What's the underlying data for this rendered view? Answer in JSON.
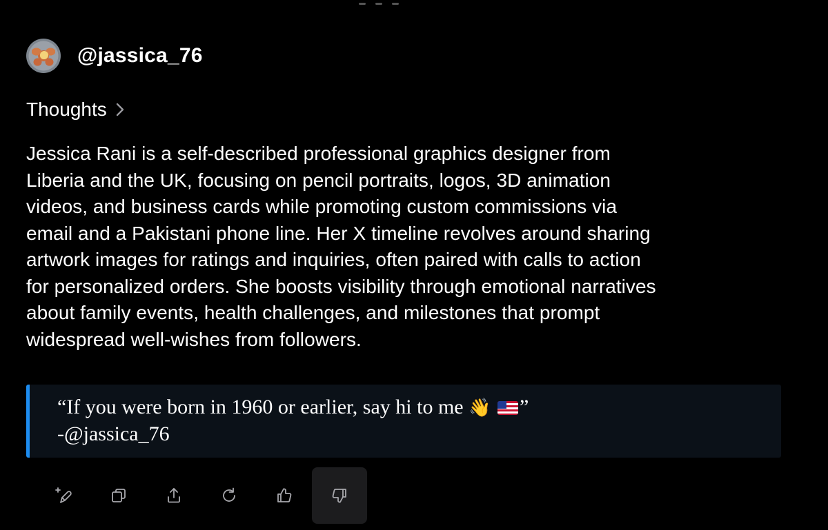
{
  "user": {
    "handle": "@jassica_76"
  },
  "thoughts": {
    "label": "Thoughts"
  },
  "summary": {
    "lines": [
      "Jessica Rani is a self-described professional graphics designer from",
      "Liberia and the UK, focusing on pencil portraits, logos, 3D animation",
      "videos, and business cards while promoting custom commissions via",
      "email and a Pakistani phone line. Her X timeline revolves around sharing",
      "artwork images for ratings and inquiries, often paired with calls to action",
      "for personalized orders. She boosts visibility through emotional narratives",
      "about family events, health challenges, and milestones that prompt",
      "widespread well-wishes from followers."
    ]
  },
  "quote": {
    "text_before_emoji": "“If you were born in 1960 or earlier, say hi to me",
    "wave_emoji": "👋",
    "flag_emoji": "🇺🇸",
    "closing_mark": "”",
    "attribution": "-@jassica_76",
    "accent_color": "#1d8cf0"
  },
  "toolbar": {
    "icons": [
      "edit-sparkle-icon",
      "copy-icon",
      "share-icon",
      "regenerate-icon",
      "thumbs-up-icon",
      "thumbs-down-icon"
    ],
    "active": "thumbs-down-icon"
  }
}
